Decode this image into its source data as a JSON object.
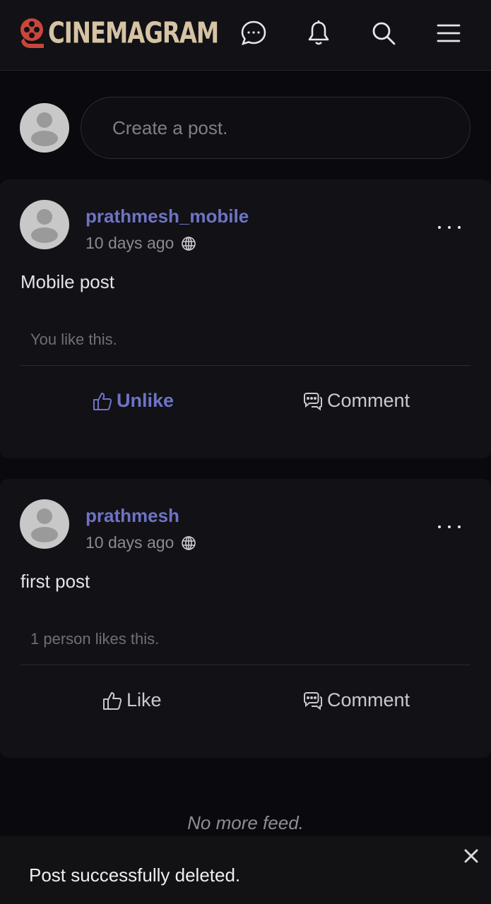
{
  "app": {
    "name": "CINEMAGRAM"
  },
  "header": {
    "icons": [
      "messages-icon",
      "bell-icon",
      "search-icon",
      "menu-icon"
    ]
  },
  "compose": {
    "placeholder": "Create a post."
  },
  "posts": [
    {
      "username": "prathmesh_mobile",
      "time": "10 days ago",
      "content": "Mobile post",
      "likes_text": "You like this.",
      "like_label": "Unlike",
      "comment_label": "Comment"
    },
    {
      "username": "prathmesh",
      "time": "10 days ago",
      "content": "first post",
      "likes_text": "1 person likes this.",
      "like_label": "Like",
      "comment_label": "Comment"
    }
  ],
  "feed_end": "No more feed.",
  "toast": {
    "message": "Post successfully deleted."
  },
  "colors": {
    "accent": "#6f73c4",
    "brand": "#d6c3a3",
    "logo_red": "#c8473a"
  }
}
